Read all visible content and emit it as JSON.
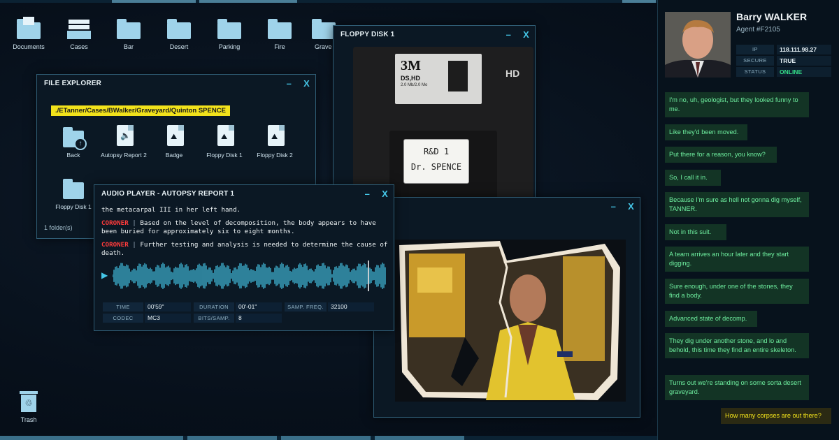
{
  "desktop": {
    "icons": [
      {
        "label": "Documents",
        "icon": "documents-folder-icon"
      },
      {
        "label": "Cases",
        "icon": "cases-tray-icon"
      },
      {
        "label": "Bar",
        "icon": "folder-icon"
      },
      {
        "label": "Desert",
        "icon": "folder-icon"
      },
      {
        "label": "Parking",
        "icon": "folder-icon"
      },
      {
        "label": "Fire",
        "icon": "folder-icon"
      },
      {
        "label": "Grave",
        "icon": "folder-icon"
      }
    ],
    "trash_label": "Trash"
  },
  "file_explorer": {
    "title": "FILE EXPLORER",
    "minimize": "–",
    "close": "X",
    "path": "./ETanner/Cases/BWalker/Graveyard/Quinton SPENCE",
    "items": [
      {
        "label": "Back",
        "icon": "back-folder-icon"
      },
      {
        "label": "Autopsy Report 2",
        "icon": "audio-file-icon"
      },
      {
        "label": "Badge",
        "icon": "image-file-icon"
      },
      {
        "label": "Floppy Disk 1",
        "icon": "image-file-icon"
      },
      {
        "label": "Floppy Disk 2",
        "icon": "image-file-icon"
      },
      {
        "label": "Floppy Disk 1",
        "icon": "folder-icon"
      }
    ],
    "status": "1 folder(s)"
  },
  "audio_player": {
    "title": "AUDIO PLAYER - AUTOPSY REPORT 1",
    "minimize": "–",
    "close": "X",
    "transcript_partial": "the metacarpal III in her left hand.",
    "lines": [
      {
        "speaker": "CORONER",
        "sep": "|",
        "text": "Based on the level of decomposition, the body appears to have been buried for approximately six to eight months."
      },
      {
        "speaker": "CORONER",
        "sep": "|",
        "text": "Further testing and analysis is needed to determine the cause of death."
      }
    ],
    "play_icon": "play-icon",
    "meta": {
      "time_label": "TIME",
      "time": "00'59\"",
      "duration_label": "DURATION",
      "duration": "00'-01\"",
      "freq_label": "SAMP. FREQ.",
      "freq": "32100",
      "codec_label": "CODEC",
      "codec": "MC3",
      "bits_label": "BITS/SAMP.",
      "bits": "8"
    }
  },
  "floppy_window": {
    "title": "FLOPPY DISK 1",
    "minimize": "–",
    "close": "X",
    "brand": "3M",
    "format": "DS,HD",
    "format_sub": "2.0 Mb/2.0 Mo",
    "hd_mark": "HD",
    "label_line1": "R&D 1",
    "label_line2": "Dr. SPENCE"
  },
  "photo_window": {
    "minimize": "–",
    "close": "X"
  },
  "agent": {
    "name": "Barry WALKER",
    "id": "Agent #F2105",
    "ip_label": "IP",
    "ip": "118.111.98.27",
    "secure_label": "SECURE",
    "secure": "TRUE",
    "status_label": "STATUS",
    "status": "ONLINE"
  },
  "chat": {
    "messages": [
      "I'm no, uh, geologist, but they looked funny to me.",
      "Like they'd been moved.",
      "Put there for a reason, you know?",
      "So, I call it in.",
      "Because I'm sure as hell not gonna dig myself, TANNER.",
      "Not in this suit.",
      "A team arrives an hour later and they start digging.",
      "Sure enough, under one of the stones, they find a body.",
      "Advanced state of decomp.",
      "They dig under another stone, and lo and behold, this time they find an entire skeleton.",
      "Turns out we're standing on some sorta desert graveyard."
    ],
    "reply": "How many corpses are out there?"
  },
  "colors": {
    "accent": "#45c7e8",
    "path_bg": "#f2e21b",
    "coroner": "#ff3b3b",
    "online": "#35e08a",
    "chat_bg": "#133425",
    "chat_text": "#6ff0a0"
  }
}
